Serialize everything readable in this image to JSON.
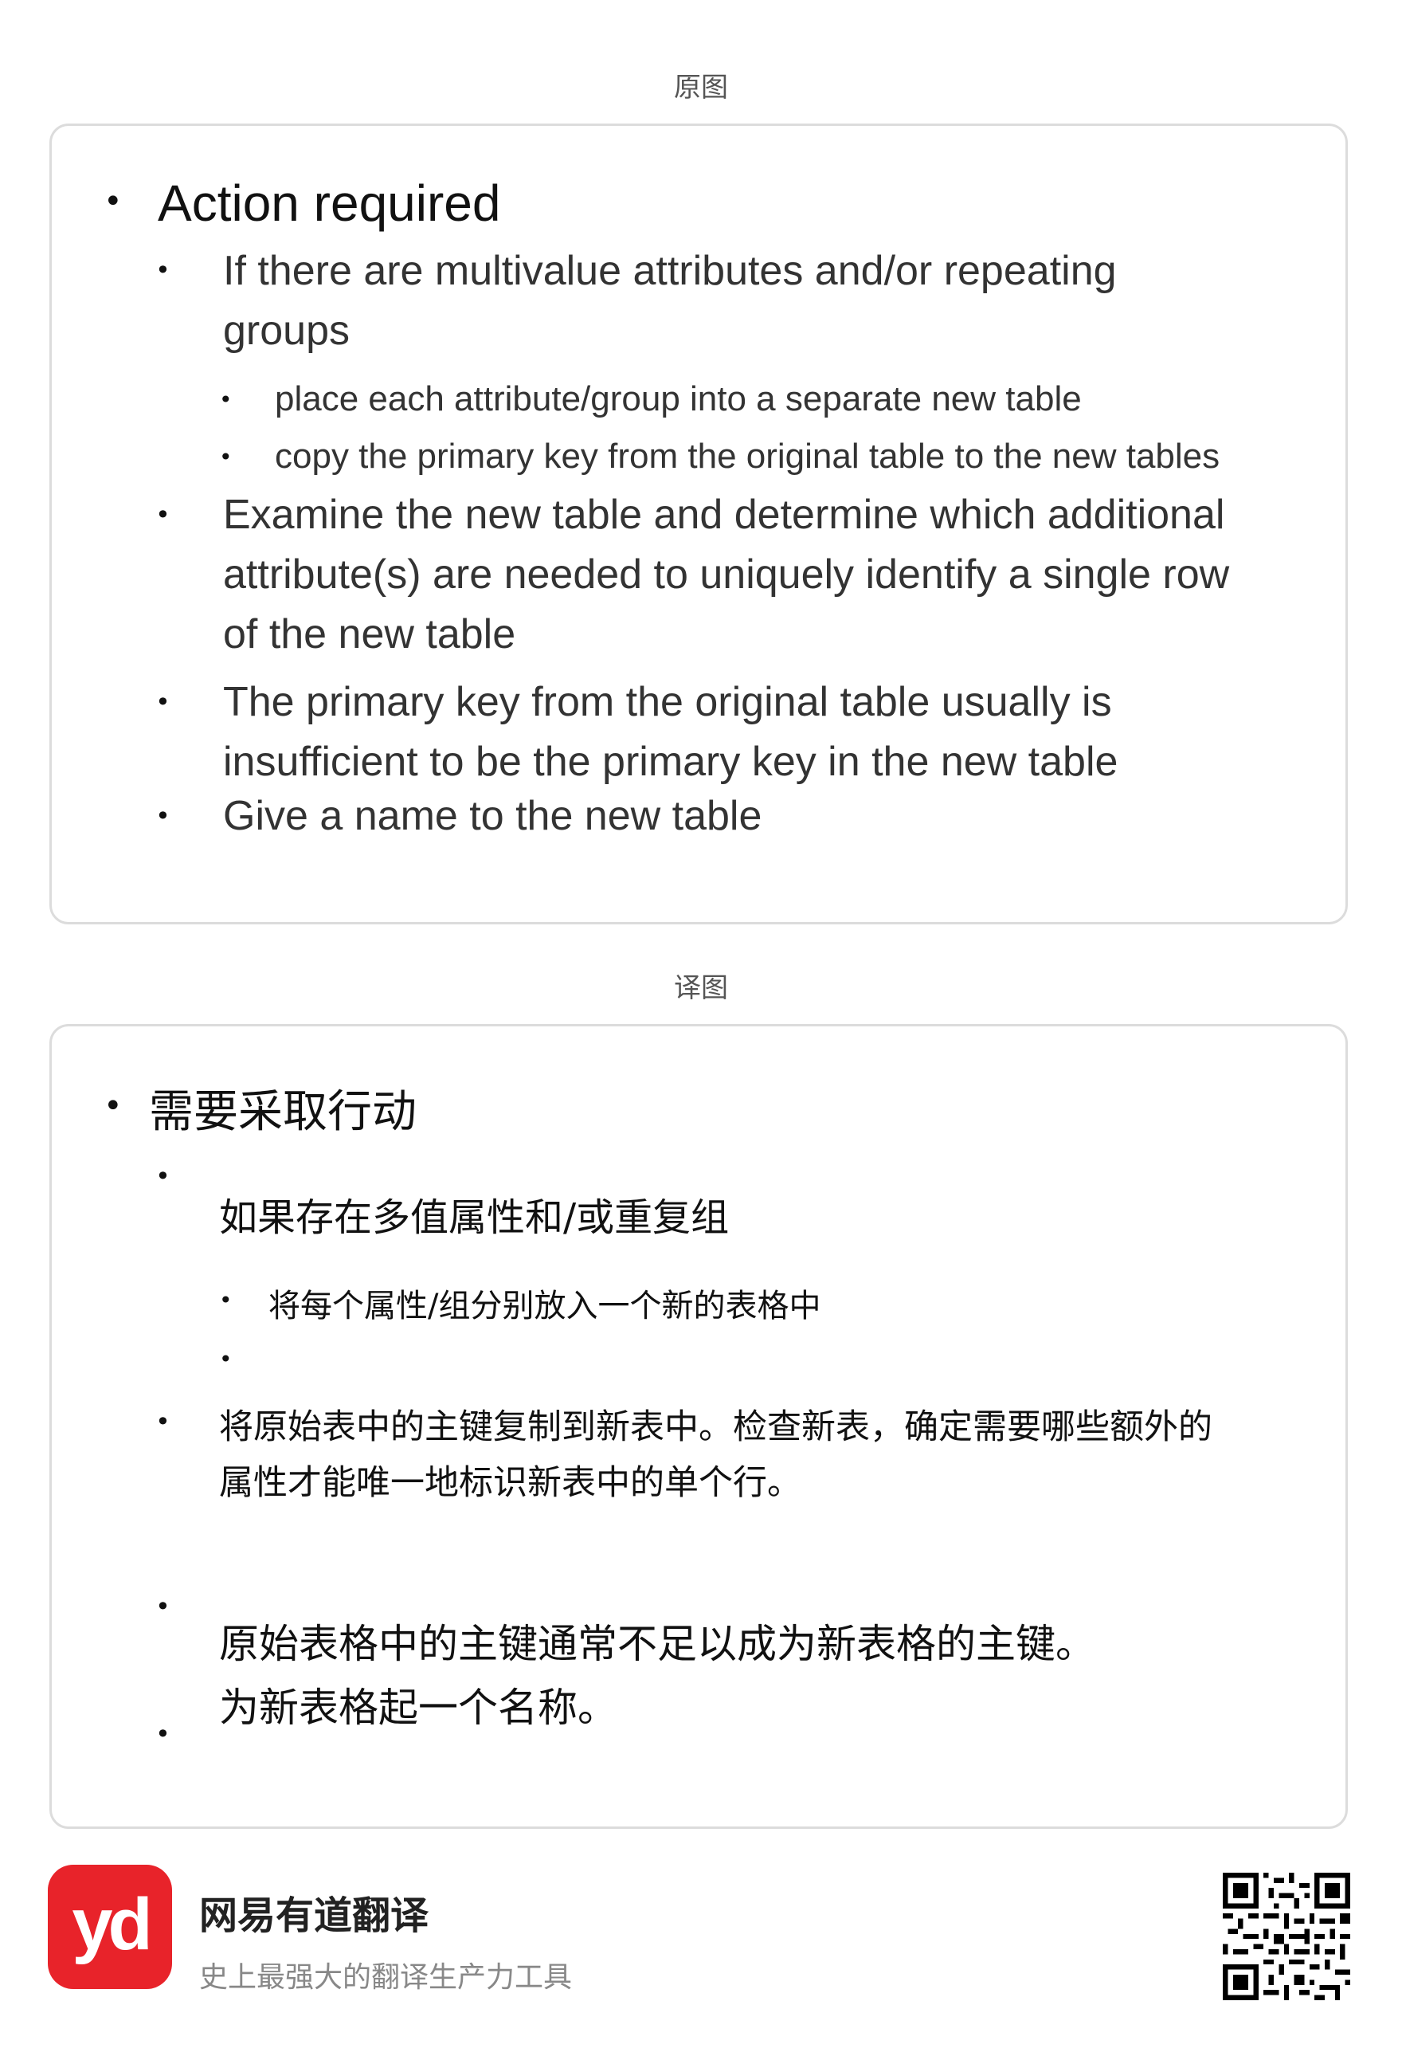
{
  "labels": {
    "original": "原图",
    "translated": "译图"
  },
  "original": {
    "heading": "Action required",
    "b1_l1": "If there are multivalue attributes and/or repeating",
    "b1_l2": "groups",
    "s1": "place each attribute/group into a separate new table",
    "s2": "copy the primary key from the original table to the new tables",
    "b2_l1": "Examine the new table and determine which additional",
    "b2_l2": "attribute(s) are needed to uniquely identify a single row",
    "b2_l3": "of the new table",
    "b3_l1": "The primary key from the original table usually is",
    "b3_l2": "insufficient to be the primary key in the new table",
    "b4": "Give a name to the new table"
  },
  "translated": {
    "heading": "需要采取行动",
    "b1": "如果存在多值属性和/或重复组",
    "s1": "将每个属性/组分别放入一个新的表格中",
    "b2_l1": "将原始表中的主键复制到新表中。检查新表，确定需要哪些额外的",
    "b2_l2": "属性才能唯一地标识新表中的单个行。",
    "b3": "原始表格中的主键通常不足以成为新表格的主键。",
    "b4": "为新表格起一个名称。"
  },
  "footer": {
    "logo_text": "yd",
    "brand": "网易有道翻译",
    "slogan": "史上最强大的翻译生产力工具",
    "qr_icon": "qr-code-icon"
  }
}
